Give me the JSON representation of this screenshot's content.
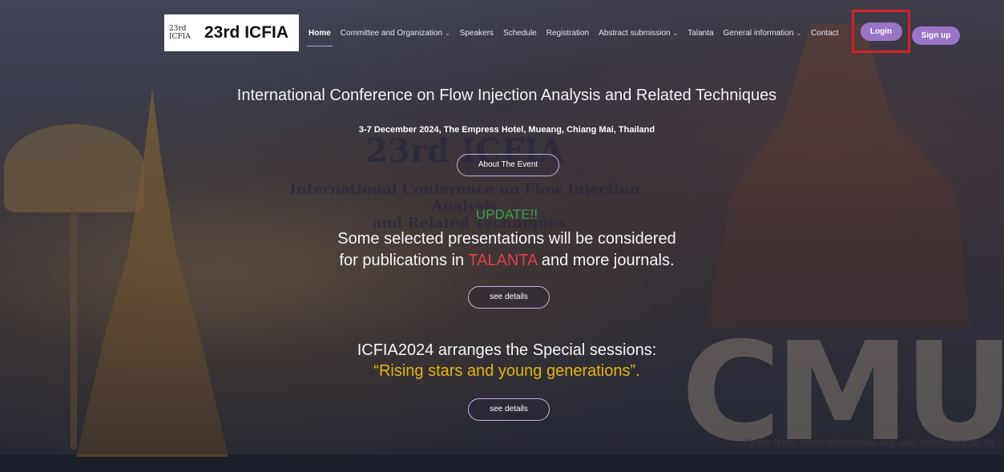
{
  "logo": {
    "mark": "23rd ICFIA",
    "text": "23rd ICFIA"
  },
  "nav": {
    "home": "Home",
    "committee": "Committee and Organization",
    "speakers": "Speakers",
    "schedule": "Schedule",
    "registration": "Registration",
    "abstract": "Abstract submission",
    "talanta": "Talanta",
    "general": "General information",
    "contact": "Contact",
    "login": "Login",
    "signup": "Sign up"
  },
  "hero": {
    "title": "International Conference on Flow Injection Analysis and Related Techniques",
    "subtitle": "3-7 December 2024, The Empress Hotel, Mueang, Chiang Mai, Thailand",
    "about_button": "About The Event",
    "update": "UPDATE!!",
    "publish_line1": "Some selected presentations will be considered",
    "publish_line2_pre": "for publications in",
    "publish_talanta": "TALANTA",
    "publish_line2_post": "and more journals.",
    "details_button_1": "see details",
    "special_line1": "ICFIA2024 arranges the Special sessions:",
    "special_line2": "“Rising stars and young generations”.",
    "details_button_2": "see details"
  },
  "background": {
    "ghost_23": "23rd ICFIA",
    "ghost_line1": "International Conference on Flow Injection Analysis",
    "ghost_line2": "and Related Techniques",
    "cmu": "CMU",
    "photo_credit": "Photo from www.wikimedia.org and www.cmu.ac.th"
  },
  "colors": {
    "accent_purple": "#9a75c6",
    "highlight_red": "#d0212a",
    "talanta_red": "#e0404a",
    "update_green": "#3aa24a",
    "rising_gold": "#e8b30f"
  }
}
